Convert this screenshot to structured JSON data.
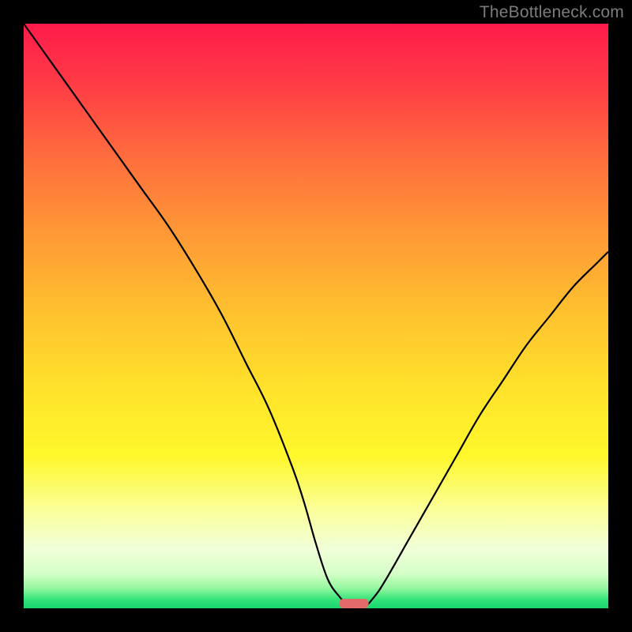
{
  "watermark": "TheBottleneck.com",
  "chart_data": {
    "type": "line",
    "title": "",
    "xlabel": "",
    "ylabel": "",
    "xlim": [
      0,
      100
    ],
    "ylim": [
      0,
      100
    ],
    "grid": false,
    "series": [
      {
        "name": "bottleneck-curve",
        "x": [
          0,
          5,
          10,
          15,
          20,
          25,
          30,
          34,
          38,
          42,
          46,
          48,
          50,
          52,
          54,
          56,
          58,
          60,
          62,
          66,
          70,
          74,
          78,
          82,
          86,
          90,
          94,
          98,
          100
        ],
        "y": [
          100,
          93,
          86,
          79,
          72,
          65,
          57,
          50,
          42,
          34,
          24,
          18,
          11,
          5,
          2,
          0,
          0,
          2,
          5,
          12,
          19,
          26,
          33,
          39,
          45,
          50,
          55,
          59,
          61
        ]
      }
    ],
    "optimum_marker": {
      "x": 56.5,
      "width": 5,
      "color": "#e26a6a"
    },
    "background_gradient": {
      "stops": [
        {
          "offset": 0.0,
          "color": "#ff1b4b"
        },
        {
          "offset": 0.1,
          "color": "#ff3b46"
        },
        {
          "offset": 0.22,
          "color": "#ff6a3e"
        },
        {
          "offset": 0.35,
          "color": "#ff9636"
        },
        {
          "offset": 0.5,
          "color": "#ffc32f"
        },
        {
          "offset": 0.62,
          "color": "#ffe12b"
        },
        {
          "offset": 0.74,
          "color": "#fff82b"
        },
        {
          "offset": 0.84,
          "color": "#faffa3"
        },
        {
          "offset": 0.9,
          "color": "#f0ffd9"
        },
        {
          "offset": 0.94,
          "color": "#d6ffc8"
        },
        {
          "offset": 0.965,
          "color": "#97f7a0"
        },
        {
          "offset": 0.985,
          "color": "#35e37a"
        },
        {
          "offset": 1.0,
          "color": "#17d66e"
        }
      ]
    }
  }
}
